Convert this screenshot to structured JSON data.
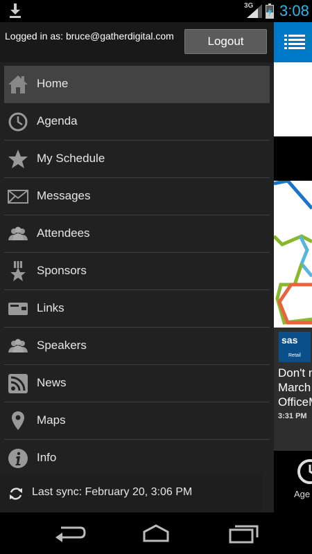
{
  "status_bar": {
    "network_type": "3G",
    "time": "3:08",
    "icons": [
      "download-icon",
      "signal-icon",
      "battery-charging-icon"
    ],
    "clock_color": "#33b5e5"
  },
  "drawer": {
    "logged_in_text": "Logged in as: bruce@gatherdigital.com",
    "logout_label": "Logout",
    "menu": [
      {
        "label": "Home",
        "icon": "home-icon",
        "active": true
      },
      {
        "label": "Agenda",
        "icon": "clock-icon",
        "active": false
      },
      {
        "label": "My Schedule",
        "icon": "star-icon",
        "active": false
      },
      {
        "label": "Messages",
        "icon": "envelope-icon",
        "active": false
      },
      {
        "label": "Attendees",
        "icon": "people-icon",
        "active": false
      },
      {
        "label": "Sponsors",
        "icon": "medal-star-icon",
        "active": false
      },
      {
        "label": "Links",
        "icon": "link-card-icon",
        "active": false
      },
      {
        "label": "Speakers",
        "icon": "people-icon",
        "active": false
      },
      {
        "label": "News",
        "icon": "rss-icon",
        "active": false
      },
      {
        "label": "Maps",
        "icon": "map-pin-icon",
        "active": false
      },
      {
        "label": "Info",
        "icon": "info-icon",
        "active": false
      }
    ],
    "sync_text": "Last sync: February 20, 3:06 PM"
  },
  "background_app": {
    "accent_color": "#0078c8",
    "news_logo": "sas",
    "news_logo_sub": "Retail",
    "news_headline": "Don't m\nMarch\nOfficeM",
    "news_time": "3:31 PM",
    "tab_label": "Age"
  },
  "nav_bar": {
    "buttons": [
      "back-icon",
      "home-nav-icon",
      "recent-apps-icon"
    ]
  }
}
